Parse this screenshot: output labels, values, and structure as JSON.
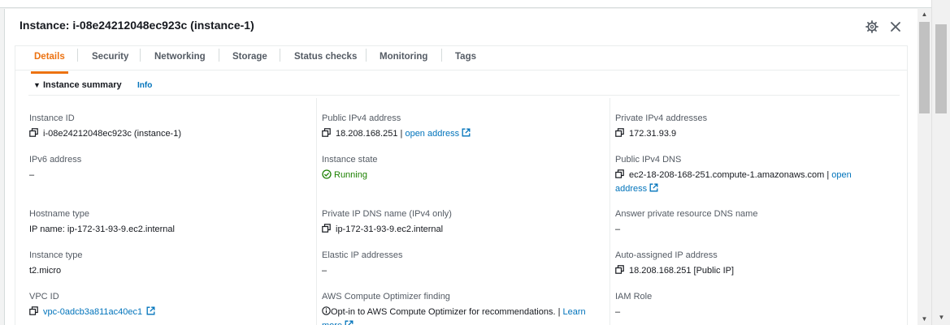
{
  "panel": {
    "title": "Instance: i-08e24212048ec923c (instance-1)"
  },
  "tabs": [
    {
      "label": "Details",
      "active": true
    },
    {
      "label": "Security"
    },
    {
      "label": "Networking"
    },
    {
      "label": "Storage"
    },
    {
      "label": "Status checks"
    },
    {
      "label": "Monitoring"
    },
    {
      "label": "Tags"
    }
  ],
  "summary": {
    "title": "Instance summary",
    "info": "Info"
  },
  "fields": {
    "instance_id": {
      "label": "Instance ID",
      "value": "i-08e24212048ec923c (instance-1)"
    },
    "public_ipv4": {
      "label": "Public IPv4 address",
      "value": "18.208.168.251",
      "sep": " | ",
      "link": "open address"
    },
    "private_ipv4": {
      "label": "Private IPv4 addresses",
      "value": "172.31.93.9"
    },
    "ipv6": {
      "label": "IPv6 address",
      "value": "–"
    },
    "instance_state": {
      "label": "Instance state",
      "value": "Running"
    },
    "public_dns": {
      "label": "Public IPv4 DNS",
      "value": "ec2-18-208-168-251.compute-1.amazonaws.com",
      "sep": " | ",
      "link": "open address"
    },
    "hostname_type": {
      "label": "Hostname type",
      "value": "IP name: ip-172-31-93-9.ec2.internal"
    },
    "private_dns": {
      "label": "Private IP DNS name (IPv4 only)",
      "value": "ip-172-31-93-9.ec2.internal"
    },
    "answer_dns": {
      "label": "Answer private resource DNS name",
      "value": "–"
    },
    "instance_type": {
      "label": "Instance type",
      "value": "t2.micro"
    },
    "elastic_ip": {
      "label": "Elastic IP addresses",
      "value": "–"
    },
    "auto_ip": {
      "label": "Auto-assigned IP address",
      "value": "18.208.168.251 [Public IP]"
    },
    "vpc_id": {
      "label": "VPC ID",
      "value": "vpc-0adcb3a811ac40ec1"
    },
    "optimizer": {
      "label": "AWS Compute Optimizer finding",
      "value": "Opt-in to AWS Compute Optimizer for recommendations.",
      "sep": " | ",
      "link": "Learn more"
    },
    "iam_role": {
      "label": "IAM Role",
      "value": "–"
    }
  },
  "icons": {
    "gear": "gear-icon",
    "close": "close-icon",
    "copy": "copy-icon",
    "external": "external-link-icon",
    "status_ok": "check-circle-icon",
    "info": "info-icon"
  },
  "colors": {
    "accent": "#ec7211",
    "link": "#0073bb",
    "success": "#1d8102"
  }
}
